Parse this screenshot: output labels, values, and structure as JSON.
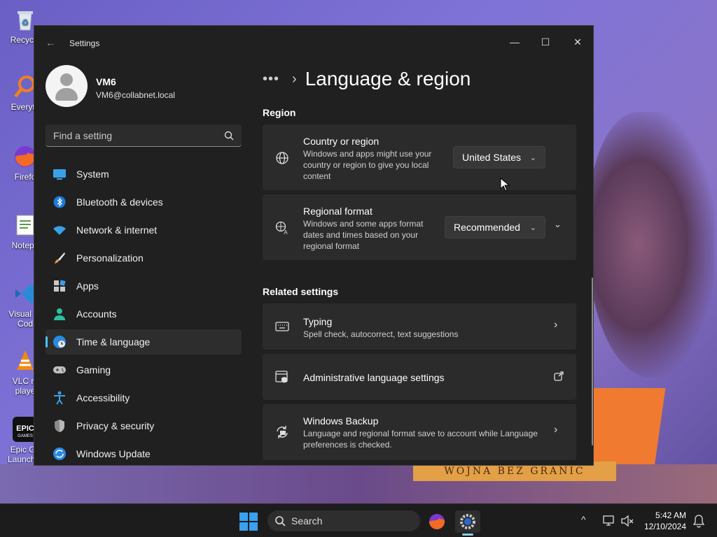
{
  "desktop": {
    "icons": [
      {
        "label": "Recycle",
        "icon": "recycle-bin-icon"
      },
      {
        "label": "Everyth",
        "icon": "everything-search-icon"
      },
      {
        "label": "Firefo",
        "icon": "firefox-icon"
      },
      {
        "label": "Notepa",
        "icon": "notepad-icon"
      },
      {
        "label": "Visual St Cod",
        "icon": "vscode-icon"
      },
      {
        "label": "VLC m playe",
        "icon": "vlc-icon"
      },
      {
        "label": "Epic Ga Launcher",
        "icon": "epic-games-icon"
      }
    ],
    "wallpaper_banner": "WOJNA BEZ GRANIC"
  },
  "window": {
    "title": "Settings",
    "back_icon": "back-arrow-icon",
    "controls": {
      "minimize": "—",
      "maximize": "☐",
      "close": "✕"
    }
  },
  "profile": {
    "name": "VM6",
    "email": "VM6@collabnet.local"
  },
  "search": {
    "placeholder": "Find a setting"
  },
  "nav": {
    "items": [
      {
        "label": "System",
        "icon": "system-icon",
        "selected": false
      },
      {
        "label": "Bluetooth & devices",
        "icon": "bluetooth-icon",
        "selected": false
      },
      {
        "label": "Network & internet",
        "icon": "wifi-icon",
        "selected": false
      },
      {
        "label": "Personalization",
        "icon": "brush-icon",
        "selected": false
      },
      {
        "label": "Apps",
        "icon": "apps-icon",
        "selected": false
      },
      {
        "label": "Accounts",
        "icon": "accounts-icon",
        "selected": false
      },
      {
        "label": "Time & language",
        "icon": "globe-clock-icon",
        "selected": true
      },
      {
        "label": "Gaming",
        "icon": "gamepad-icon",
        "selected": false
      },
      {
        "label": "Accessibility",
        "icon": "accessibility-icon",
        "selected": false
      },
      {
        "label": "Privacy & security",
        "icon": "shield-icon",
        "selected": false
      },
      {
        "label": "Windows Update",
        "icon": "update-icon",
        "selected": false
      }
    ]
  },
  "page": {
    "breadcrumb_overflow": "•••",
    "title": "Language & region",
    "region_section": "Region",
    "country": {
      "title": "Country or region",
      "desc": "Windows and apps might use your country or region to give you local content",
      "value": "United States"
    },
    "format": {
      "title": "Regional format",
      "desc": "Windows and some apps format dates and times based on your regional format",
      "value": "Recommended"
    },
    "related_section": "Related settings",
    "typing": {
      "title": "Typing",
      "desc": "Spell check, autocorrect, text suggestions"
    },
    "admin": {
      "title": "Administrative language settings"
    },
    "backup": {
      "title": "Windows Backup",
      "desc": "Language and regional format save to account while Language preferences is checked."
    }
  },
  "taskbar": {
    "search_label": "Search",
    "time": "5:42 AM",
    "date": "12/10/2024"
  },
  "colors": {
    "accent": "#4cc2ff",
    "window_bg": "#202020",
    "card_bg": "#2b2b2b"
  }
}
